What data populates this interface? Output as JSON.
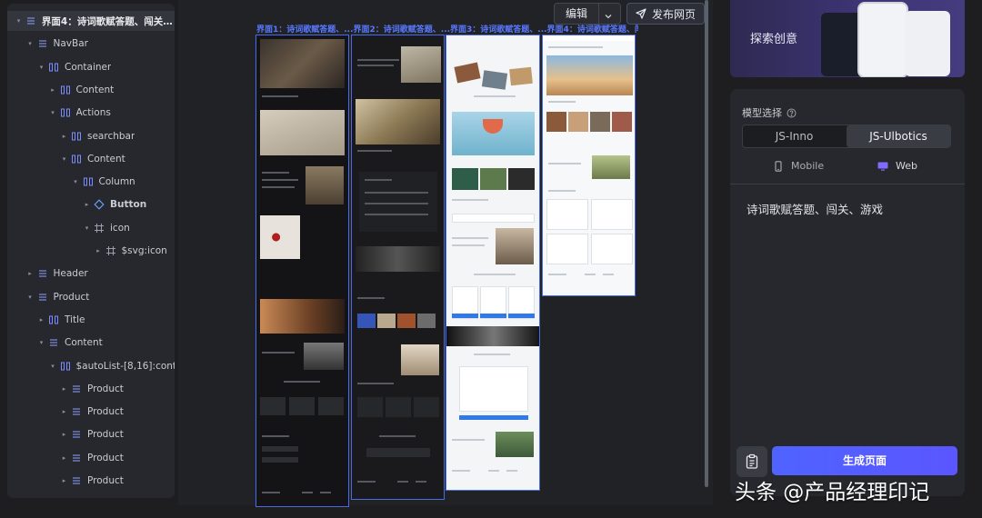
{
  "layers": {
    "rows": [
      {
        "label": "界面4：诗词歌赋答题、闯关、...",
        "icon": "stack",
        "depth": 0,
        "expanded": true,
        "selected": true
      },
      {
        "label": "NavBar",
        "icon": "stack",
        "depth": 1,
        "expanded": true
      },
      {
        "label": "Container",
        "icon": "container",
        "depth": 2,
        "expanded": true
      },
      {
        "label": "Content",
        "icon": "container",
        "depth": 3,
        "expanded": false
      },
      {
        "label": "Actions",
        "icon": "container",
        "depth": 3,
        "expanded": true
      },
      {
        "label": "searchbar",
        "icon": "container",
        "depth": 4,
        "expanded": false
      },
      {
        "label": "Content",
        "icon": "container",
        "depth": 4,
        "expanded": true
      },
      {
        "label": "Column",
        "icon": "container",
        "depth": 5,
        "expanded": true
      },
      {
        "label": "Button",
        "icon": "component",
        "depth": 6,
        "expanded": false,
        "bold": true
      },
      {
        "label": "icon",
        "icon": "frame",
        "depth": 6,
        "expanded": true
      },
      {
        "label": "$svg:icon",
        "icon": "frame",
        "depth": 7,
        "expanded": false
      },
      {
        "label": "Header",
        "icon": "stack",
        "depth": 1,
        "expanded": false
      },
      {
        "label": "Product",
        "icon": "stack",
        "depth": 1,
        "expanded": true
      },
      {
        "label": "Title",
        "icon": "container",
        "depth": 2,
        "expanded": false
      },
      {
        "label": "Content",
        "icon": "stack",
        "depth": 2,
        "expanded": true
      },
      {
        "label": "$autoList-[8,16]:cont...",
        "icon": "container",
        "depth": 3,
        "expanded": true
      },
      {
        "label": "Product",
        "icon": "stack",
        "depth": 4,
        "expanded": false
      },
      {
        "label": "Product",
        "icon": "stack",
        "depth": 4,
        "expanded": false
      },
      {
        "label": "Product",
        "icon": "stack",
        "depth": 4,
        "expanded": false
      },
      {
        "label": "Product",
        "icon": "stack",
        "depth": 4,
        "expanded": false
      },
      {
        "label": "Product",
        "icon": "stack",
        "depth": 4,
        "expanded": false
      }
    ]
  },
  "tools": [
    {
      "name": "hand-icon"
    },
    {
      "name": "target-icon"
    },
    {
      "name": "trash-icon"
    }
  ],
  "toolbar": {
    "edit_label": "编辑",
    "publish_label": "发布网页"
  },
  "canvas": {
    "screen_labels": "界面1：诗词歌赋答题、...界面2：诗词歌赋答题、...界面3：诗词歌赋答题、...界面4：诗词歌赋答题、闯关..."
  },
  "promo": {
    "text": "探索创意"
  },
  "ai_panel": {
    "model_label": "模型选择",
    "models": [
      "JS-Inno",
      "JS-Ulbotics"
    ],
    "selected_model": "JS-Ulbotics",
    "devices": [
      "Mobile",
      "Web"
    ],
    "selected_device": "Web",
    "prompt": "诗词歌赋答题、闯关、游戏",
    "generate_label": "生成页面"
  },
  "colors": {
    "accent": "#5b5cff",
    "selection_outline": "#4a6be8",
    "tool_highlight": "#e0302a"
  },
  "watermark": "头条 @产品经理印记"
}
